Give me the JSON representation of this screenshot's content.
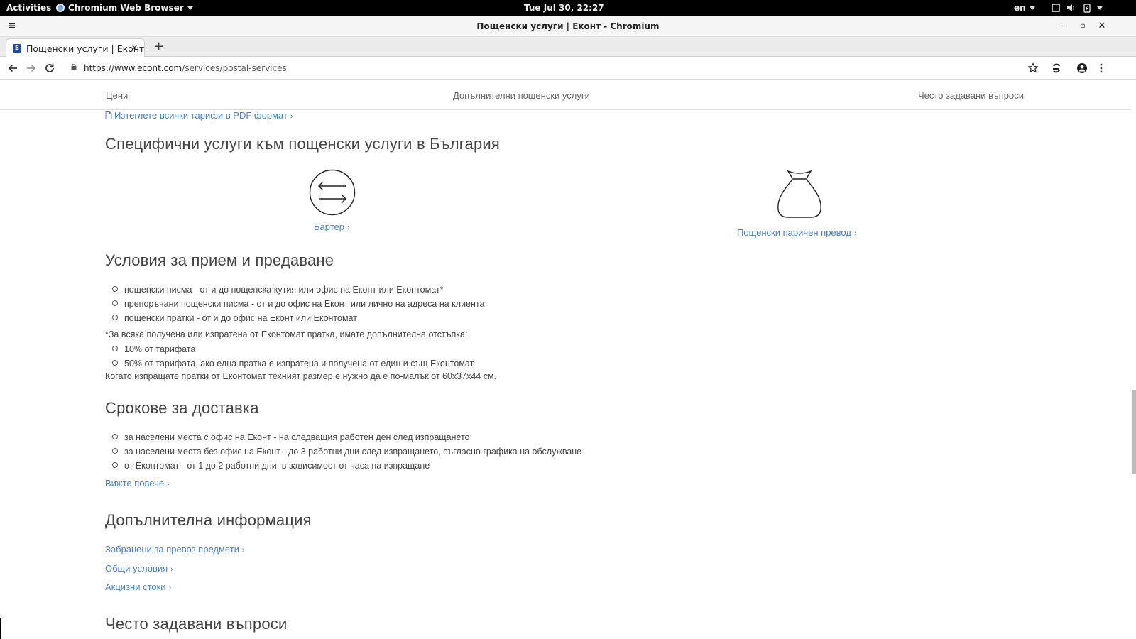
{
  "system_bar": {
    "activities": "Activities",
    "app_menu": "Chromium Web Browser",
    "clock": "Tue Jul 30, 22:27",
    "language": "en"
  },
  "window": {
    "title": "Пощенски услуги | Еконт - Chromium"
  },
  "tab": {
    "title": "Пощенски услуги | Еконт",
    "close": "×",
    "new_tab": "+"
  },
  "address_bar": {
    "url_host": "https://www.econt.com",
    "url_path": "/services/postal-services"
  },
  "subnav": {
    "items": [
      "Цени",
      "Допълнителни пощенски услуги",
      "Често задавани въпроси"
    ]
  },
  "content": {
    "pdf_link": "Изтеглете всички тарифи в PDF формат",
    "specific_heading": "Специфични услуги към пощенски услуги в България",
    "services": [
      {
        "label": "Бартер",
        "icon": "barter-arrows-icon"
      },
      {
        "label": "Пощенски паричен превод",
        "icon": "money-bag-icon"
      }
    ],
    "conditions_heading": "Условия за прием и предаване",
    "conditions_items": [
      "пощенски писма - от и до пощенска кутия или офис на Еконт или Еконтомат*",
      "препоръчани пощенски писма - от и до офис на Еконт или лично на адреса на клиента",
      "пощенски пратки - от и до офис на Еконт или Еконтомат"
    ],
    "discount_note": "*За всяка получена или изпратена от Еконтомат пратка, имате допълнителна отстъпка:",
    "discount_items": [
      "10% от тарифата",
      "50% от тарифата, ако една пратка е изпратена и получена от един и същ Еконтомат"
    ],
    "size_note": "Когато изпращате пратки от Еконтомат техният размер е нужно да е по-малък от 60х37х44 см.",
    "delivery_heading": "Срокове за доставка",
    "delivery_items": [
      "за населени места с офис на Еконт - на следващия работен ден след изпращането",
      "за населени места без офис на Еконт - до 3 работни дни след изпращането, съгласно графика на обслужване",
      "от Еконтомат - от 1 до 2 работни дни, в зависимост от часа на изпращане"
    ],
    "see_more": "Вижте повече",
    "additional_heading": "Допълнителна информация",
    "additional_links": [
      "Забранени за превоз предмети",
      "Общи условия",
      "Акцизни стоки"
    ],
    "faq_heading": "Често задавани въпроси"
  }
}
